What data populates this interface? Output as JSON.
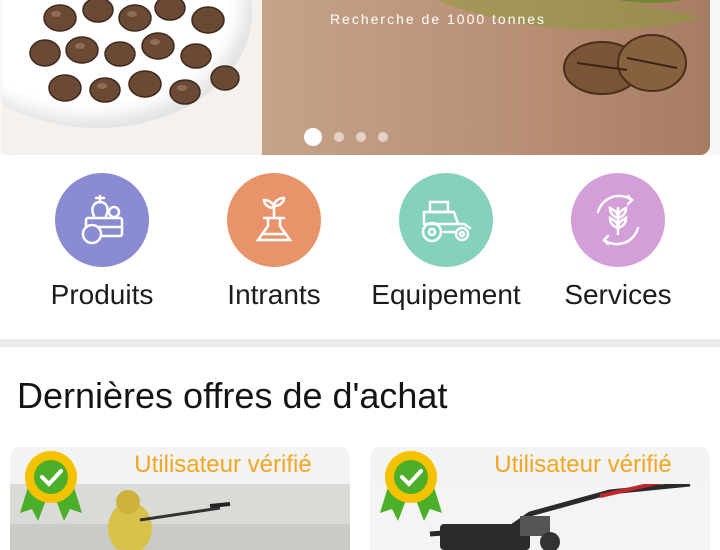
{
  "banner": {
    "text": "Recherche de 1000 tonnes",
    "slides": 4,
    "active_slide": 1
  },
  "categories": [
    {
      "label": "Produits",
      "icon": "vegetable-crate-icon",
      "color": "#8a8bd1"
    },
    {
      "label": "Intrants",
      "icon": "flask-sprout-icon",
      "color": "#e8936a"
    },
    {
      "label": "Equipement",
      "icon": "tractor-icon",
      "color": "#86d1bd"
    },
    {
      "label": "Services",
      "icon": "wheat-cycle-icon",
      "color": "#d49ed8"
    }
  ],
  "offers_section": {
    "title": "Dernières offres de d'achat",
    "cards": [
      {
        "badge": "Utilisateur vérifié",
        "image": "sprayer-worker-photo"
      },
      {
        "badge": "Utilisateur vérifié",
        "image": "tiller-machine-photo"
      }
    ]
  },
  "colors": {
    "verified_text": "#f2a623",
    "badge_gold": "#f5c200",
    "badge_green": "#4caf2a"
  }
}
